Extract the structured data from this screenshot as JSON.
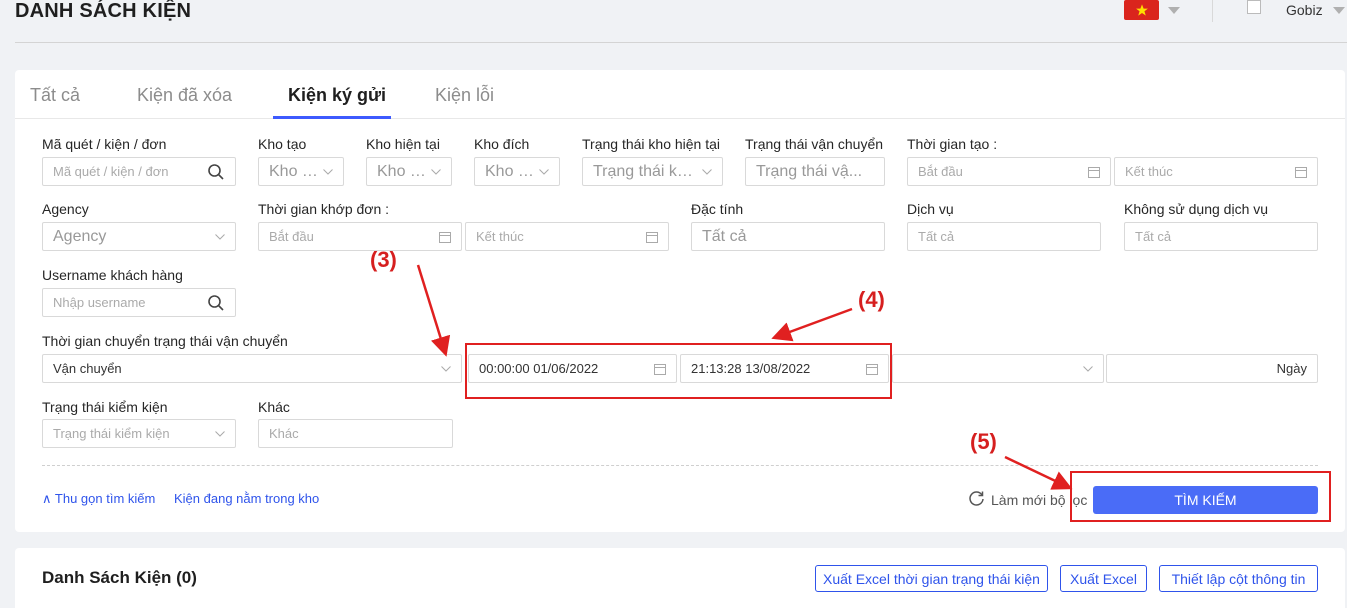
{
  "header": {
    "title": "DANH SÁCH KIỆN",
    "user": "Gobiz"
  },
  "tabs": [
    {
      "label": "Tất cả"
    },
    {
      "label": "Kiện đã xóa"
    },
    {
      "label": "Kiện ký gửi",
      "active": true
    },
    {
      "label": "Kiện lỗi"
    }
  ],
  "filters": {
    "code": {
      "label": "Mã quét / kiện / đơn",
      "placeholder": "Mã quét / kiện / đơn"
    },
    "kho_tao": {
      "label": "Kho tạo",
      "placeholder": "Kho tạo"
    },
    "kho_hien_tai": {
      "label": "Kho hiện tại",
      "placeholder": "Kho hi..."
    },
    "kho_dich": {
      "label": "Kho đích",
      "placeholder": "Kho đí..."
    },
    "trang_thai_kho": {
      "label": "Trạng thái kho hiện tại",
      "placeholder": "Trạng thái kho..."
    },
    "trang_thai_vc": {
      "label": "Trạng thái vận chuyển",
      "placeholder": "Trạng thái vậ..."
    },
    "thoi_gian_tao": {
      "label": "Thời gian tạo :",
      "start": "Bắt đầu",
      "end": "Kết thúc"
    },
    "agency": {
      "label": "Agency",
      "placeholder": "Agency"
    },
    "thoi_gian_khop": {
      "label": "Thời gian khớp đơn :",
      "start": "Bắt đầu",
      "end": "Kết thúc"
    },
    "dac_tinh": {
      "label": "Đặc tính",
      "placeholder": "Tất cả"
    },
    "dich_vu": {
      "label": "Dịch vụ",
      "placeholder": "Tất cả"
    },
    "khong_dich_vu": {
      "label": "Không sử dụng dịch vụ",
      "placeholder": "Tất cả"
    },
    "username": {
      "label": "Username khách hàng",
      "placeholder": "Nhập username"
    },
    "chuyen_trang_thai": {
      "label": "Thời gian chuyển trạng thái vận chuyển",
      "status": "Vận chuyển",
      "start": "00:00:00 01/06/2022",
      "end": "21:13:28 13/08/2022",
      "unit": "Ngày"
    },
    "kiem_kien": {
      "label": "Trạng thái kiểm kiện",
      "placeholder": "Trạng thái kiểm kiện"
    },
    "khac": {
      "label": "Khác",
      "placeholder": "Khác"
    }
  },
  "actions": {
    "collapse": "Thu gọn tìm kiếm",
    "in_stock": "Kiện đang nằm trong kho",
    "reset": "Làm mới bộ lọc",
    "search": "TÌM KIẾM"
  },
  "list": {
    "title": "Danh Sách Kiện (0)",
    "btn_export_status": "Xuất Excel thời gian trạng thái kiện",
    "btn_export": "Xuất Excel",
    "btn_columns": "Thiết lập cột thông tin"
  },
  "annotations": {
    "a3": "(3)",
    "a4": "(4)",
    "a5": "(5)"
  }
}
